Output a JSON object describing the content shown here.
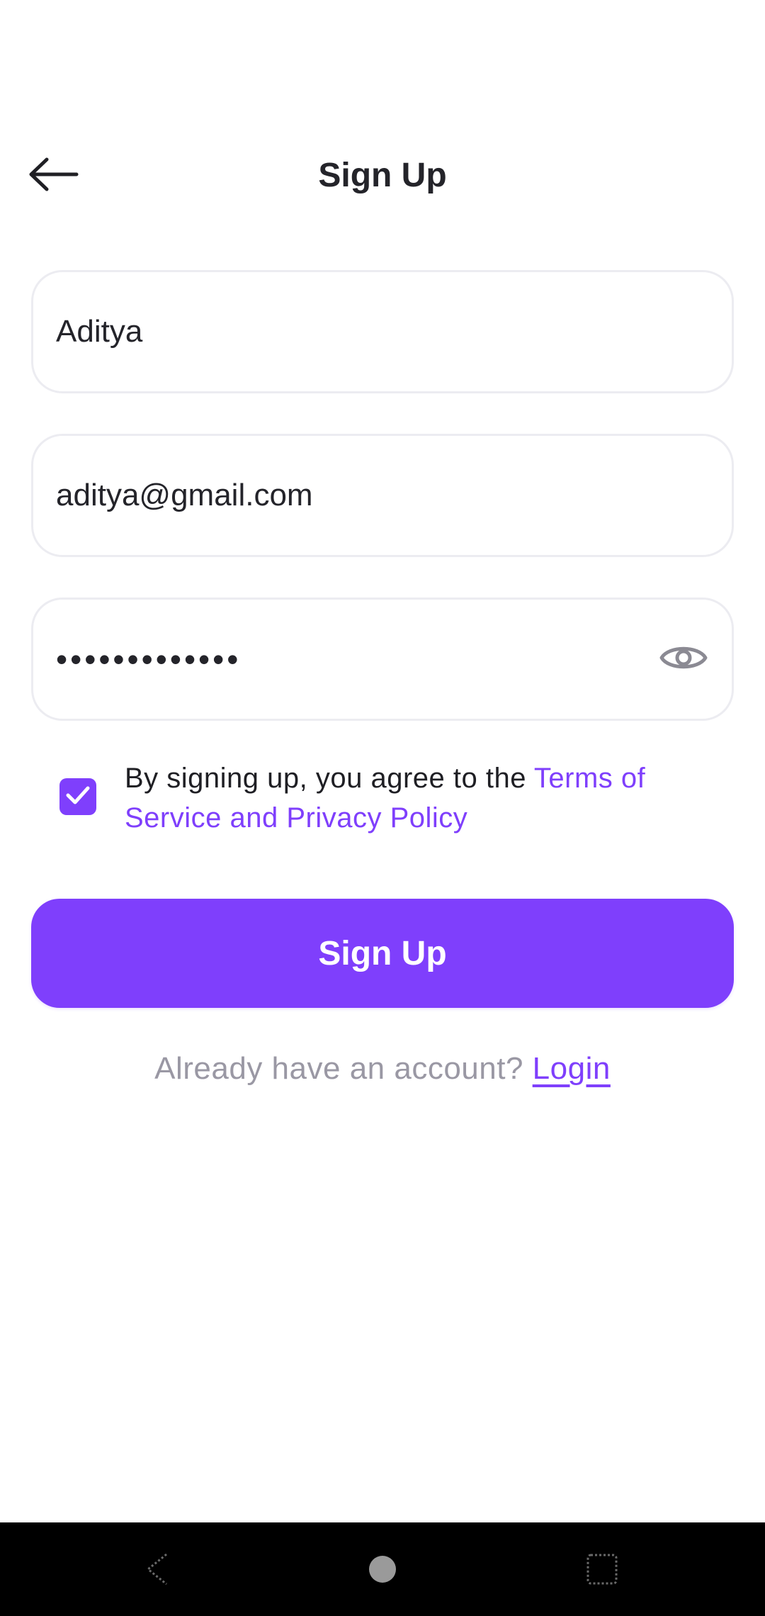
{
  "header": {
    "title": "Sign Up",
    "back_icon": "arrow-left-icon"
  },
  "form": {
    "name_value": "Aditya",
    "email_value": "aditya@gmail.com",
    "password_value": "•••••••••••••",
    "password_toggle_icon": "eye-icon"
  },
  "terms": {
    "checked": true,
    "text": "By signing up, you agree to the ",
    "link_text": "Terms of Service and Privacy Policy"
  },
  "actions": {
    "sign_up_label": "Sign Up"
  },
  "login_prompt": {
    "text": "Already have an account? ",
    "link_text": "Login"
  },
  "system_nav": {
    "back_icon": "nav-back-icon",
    "home_icon": "nav-home-icon",
    "recents_icon": "nav-recents-icon"
  },
  "colors": {
    "accent": "#7f3ffc",
    "text_primary": "#24242a",
    "text_muted": "#9a98a4",
    "field_border": "#ececf1",
    "nav_bar": "#000000"
  }
}
